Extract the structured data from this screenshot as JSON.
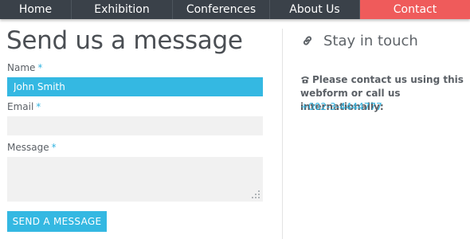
{
  "nav": {
    "items": [
      {
        "label": "Home"
      },
      {
        "label": "Exhibition"
      },
      {
        "label": "Conferences"
      },
      {
        "label": "About Us"
      },
      {
        "label": "Contact"
      }
    ],
    "active_color": "#ef5b5b",
    "bar_color": "#3a4149"
  },
  "form": {
    "title": "Send us a message",
    "required_mark": "*",
    "name": {
      "label": "Name",
      "value": "John Smith"
    },
    "email": {
      "label": "Email",
      "value": ""
    },
    "message": {
      "label": "Message",
      "value": ""
    },
    "submit_label": "SEND A MESSAGE",
    "accent_color": "#34b8e2"
  },
  "sidebar": {
    "title": "Stay in touch",
    "title_icon": "link-icon",
    "contact_icon": "phone-icon",
    "contact_text": "Please contact us using this webform or call us internationally:",
    "phone": "+002-3-4444777"
  }
}
